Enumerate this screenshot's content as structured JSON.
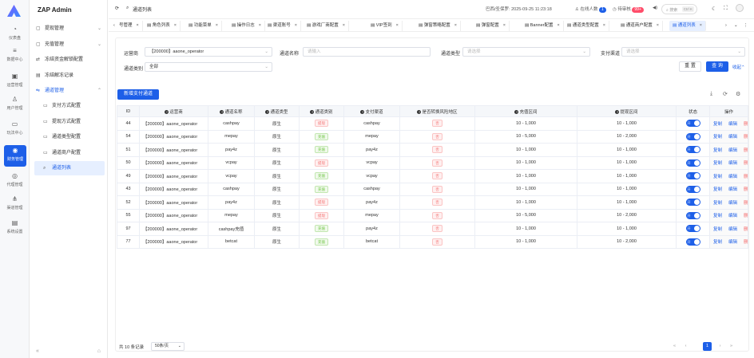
{
  "app": {
    "brand": "ZAP Admin"
  },
  "rail": [
    {
      "icon": "dashboard-icon",
      "label": "仪表盘"
    },
    {
      "icon": "database-icon",
      "label": "数据中心"
    },
    {
      "icon": "operation-icon",
      "label": "运营管理"
    },
    {
      "icon": "user-icon",
      "label": "用户管理"
    },
    {
      "icon": "game-icon",
      "label": "玩法中心"
    },
    {
      "icon": "finance-icon",
      "label": "财务管理"
    },
    {
      "icon": "proxy-icon",
      "label": "代理管理"
    },
    {
      "icon": "channel-icon",
      "label": "渠道管理"
    },
    {
      "icon": "settings-icon",
      "label": "系统设置"
    }
  ],
  "menu": [
    {
      "label": "提现管理",
      "type": "group"
    },
    {
      "label": "充值管理",
      "type": "group"
    },
    {
      "label": "冻结资金解锁配置",
      "type": "item"
    },
    {
      "label": "冻结解冻记录",
      "type": "item"
    },
    {
      "label": "通道管理",
      "type": "group-open"
    },
    {
      "label": "支付方式配置",
      "type": "sub"
    },
    {
      "label": "提现方式配置",
      "type": "sub"
    },
    {
      "label": "通道类型配置",
      "type": "sub"
    },
    {
      "label": "通道商户配置",
      "type": "sub"
    },
    {
      "label": "通道列表",
      "type": "sub-selected"
    }
  ],
  "header": {
    "breadcrumb": "通道列表",
    "timezone": "巴西/圣保罗: 2025-09-25 11:23:18",
    "online_label": "在线人数",
    "online_count": "1",
    "pending_label": "待审核",
    "pending_count": "99+",
    "search_placeholder": "搜索",
    "search_shortcut": "Ctrl K"
  },
  "tabs": [
    "号管理",
    "角色列表",
    "功能菜单",
    "操作日志",
    "渠道账号",
    "游戏厂商配置",
    "VIP签到",
    "弹窗策略配置",
    "弹窗配置",
    "Banner配置",
    "通道类型配置",
    "通道商户配置",
    "通道列表"
  ],
  "filters": {
    "operator_label": "运营商",
    "operator_value": "【200000】aaone_operator",
    "channel_name_label": "通道名称",
    "channel_name_placeholder": "请输入",
    "channel_type_label": "通道类型",
    "channel_type_placeholder": "请选择",
    "pay_channel_label": "支付渠道",
    "pay_channel_placeholder": "请选择",
    "channel_category_label": "通道类别",
    "channel_category_value": "全部",
    "reset_label": "重 置",
    "query_label": "查 询",
    "collapse_label": "收起"
  },
  "toolbar": {
    "add_label": "新增支付通道"
  },
  "table": {
    "headers": [
      "ID",
      "运营商",
      "通道名称",
      "通道类型",
      "通道类别",
      "支付渠道",
      "是否转换风险地区",
      "充值区间",
      "提现区间",
      "状态",
      "操作"
    ],
    "rows": [
      {
        "id": "44",
        "operator": "【200000】aaone_operator",
        "name": "cashpay",
        "type": "原生",
        "category": "提现",
        "channel": "cashpay",
        "risk": "否",
        "deposit": "10 - 1,000",
        "withdraw": "10 - 1,000",
        "status": "开"
      },
      {
        "id": "54",
        "operator": "【200000】aaone_operator",
        "name": "mepay",
        "type": "原生",
        "category": "充值",
        "channel": "mepay",
        "risk": "否",
        "deposit": "10 - 5,000",
        "withdraw": "10 - 2,000",
        "status": "开"
      },
      {
        "id": "51",
        "operator": "【200000】aaone_operator",
        "name": "pay4z",
        "type": "原生",
        "category": "充值",
        "channel": "pay4z",
        "risk": "否",
        "deposit": "10 - 1,000",
        "withdraw": "10 - 1,000",
        "status": "开"
      },
      {
        "id": "50",
        "operator": "【200000】aaone_operator",
        "name": "vcpay",
        "type": "原生",
        "category": "提现",
        "channel": "vcpay",
        "risk": "否",
        "deposit": "10 - 1,000",
        "withdraw": "10 - 1,000",
        "status": "开"
      },
      {
        "id": "49",
        "operator": "【200000】aaone_operator",
        "name": "vcpay",
        "type": "原生",
        "category": "充值",
        "channel": "vcpay",
        "risk": "否",
        "deposit": "10 - 1,000",
        "withdraw": "10 - 1,000",
        "status": "开"
      },
      {
        "id": "43",
        "operator": "【200000】aaone_operator",
        "name": "cashpay",
        "type": "原生",
        "category": "充值",
        "channel": "cashpay",
        "risk": "否",
        "deposit": "10 - 1,000",
        "withdraw": "10 - 1,000",
        "status": "开"
      },
      {
        "id": "52",
        "operator": "【200000】aaone_operator",
        "name": "pay4z",
        "type": "原生",
        "category": "提现",
        "channel": "pay4z",
        "risk": "否",
        "deposit": "10 - 1,000",
        "withdraw": "10 - 1,000",
        "status": "开"
      },
      {
        "id": "55",
        "operator": "【200000】aaone_operator",
        "name": "mepay",
        "type": "原生",
        "category": "提现",
        "channel": "mepay",
        "risk": "否",
        "deposit": "10 - 5,000",
        "withdraw": "10 - 2,000",
        "status": "开"
      },
      {
        "id": "97",
        "operator": "【200000】aaone_operator",
        "name": "cashpay充值",
        "type": "原生",
        "category": "充值",
        "channel": "pay4z",
        "risk": "否",
        "deposit": "10 - 1,000",
        "withdraw": "10 - 1,000",
        "status": "开"
      },
      {
        "id": "77",
        "operator": "【200000】aaone_operator",
        "name": "betcat",
        "type": "原生",
        "category": "充值",
        "channel": "betcat",
        "risk": "否",
        "deposit": "10 - 1,000",
        "withdraw": "10 - 2,000",
        "status": "开"
      }
    ],
    "actions": {
      "copy": "复制",
      "edit": "编辑",
      "delete": "删除"
    }
  },
  "pagination": {
    "total": "共 10 条记录",
    "page_size": "50条/页",
    "current": "1"
  },
  "colors": {
    "primary": "#1d5fe8",
    "danger": "#f56c6c",
    "success": "#67c23a"
  }
}
